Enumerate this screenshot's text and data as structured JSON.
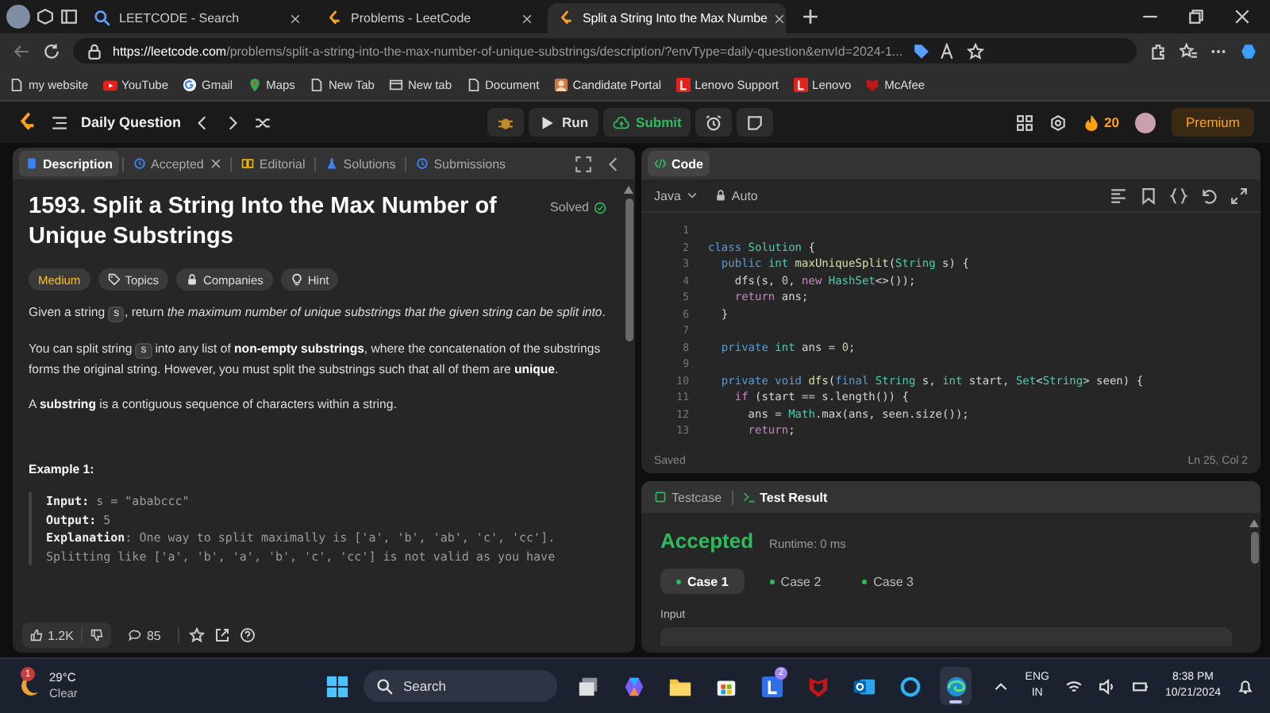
{
  "browser": {
    "tabs": [
      {
        "title": "LEETCODE - Search",
        "kind": "search",
        "selected": false
      },
      {
        "title": "Problems - LeetCode",
        "kind": "site",
        "selected": false
      },
      {
        "title": "Split a String Into the Max Numbe",
        "kind": "site",
        "selected": true
      }
    ],
    "url": {
      "host": "https://leetcode.com",
      "rest": "/problems/split-a-string-into-the-max-number-of-unique-substrings/description/?envType=daily-question&envId=2024-1..."
    },
    "bookmarks": [
      {
        "label": "my website",
        "kind": "page"
      },
      {
        "label": "YouTube",
        "kind": "youtube"
      },
      {
        "label": "Gmail",
        "kind": "google"
      },
      {
        "label": "Maps",
        "kind": "maps"
      },
      {
        "label": "New Tab",
        "kind": "page"
      },
      {
        "label": "New tab",
        "kind": "tab"
      },
      {
        "label": "Document",
        "kind": "page"
      },
      {
        "label": "Candidate Portal",
        "kind": "portal"
      },
      {
        "label": "Lenovo Support",
        "kind": "lenovo"
      },
      {
        "label": "Lenovo",
        "kind": "lenovo"
      },
      {
        "label": "McAfee",
        "kind": "mcafee"
      }
    ]
  },
  "header": {
    "title": "Daily Question",
    "run": "Run",
    "submit": "Submit",
    "streak": "20",
    "premium": "Premium"
  },
  "problem_panel": {
    "tabs": [
      {
        "label": "Description",
        "kind": "doc",
        "selected": true,
        "closable": false
      },
      {
        "label": "Accepted",
        "kind": "clock",
        "selected": false,
        "closable": true
      },
      {
        "label": "Editorial",
        "kind": "book",
        "selected": false,
        "closable": false
      },
      {
        "label": "Solutions",
        "kind": "flask",
        "selected": false,
        "closable": false
      },
      {
        "label": "Submissions",
        "kind": "clock",
        "selected": false,
        "closable": false
      }
    ],
    "title": "1593. Split a String Into the Max Number of Unique Substrings",
    "status": "Solved",
    "tags": [
      {
        "label": "Medium",
        "kind": "difficulty"
      },
      {
        "label": "Topics",
        "kind": "tag"
      },
      {
        "label": "Companies",
        "kind": "lock"
      },
      {
        "label": "Hint",
        "kind": "bulb"
      }
    ],
    "paragraphs": [
      [
        {
          "kind": "text",
          "text": "Given a string "
        },
        {
          "kind": "code",
          "text": "s"
        },
        {
          "kind": "text",
          "text": ", return *the maximum number of unique substrings that the given string can be split into*."
        }
      ],
      [
        {
          "kind": "text",
          "text": "You can split string "
        },
        {
          "kind": "code",
          "text": "s"
        },
        {
          "kind": "text",
          "text": " into any list of **non-empty substrings**, where the concatenation of the substrings forms the original string. However, you must split the substrings such that all of them are **unique**."
        }
      ],
      [
        {
          "kind": "text",
          "text": "A **substring** is a contiguous sequence of characters within a string."
        }
      ]
    ],
    "example": {
      "heading": "Example 1:",
      "lines": [
        "**Input:** s = \"ababccc\"",
        "**Output:** 5",
        "**Explanation**: One way to split maximally is ['a', 'b', 'ab', 'c', 'cc'].",
        "Splitting like ['a', 'b', 'a', 'b', 'c', 'cc'] is not valid as you have"
      ]
    },
    "likes": "1.2K",
    "comments": "85"
  },
  "code_panel": {
    "title": "Code",
    "language": "Java",
    "mode": "Auto",
    "lines": [
      {
        "number": "1"
      },
      {
        "number": "2",
        "tokens": [
          {
            "text": "class ",
            "kind": "kw"
          },
          {
            "text": "Solution",
            "kind": "type"
          },
          {
            "text": " {",
            "kind": "plain"
          }
        ]
      },
      {
        "number": "3",
        "tokens": [
          {
            "text": "  public ",
            "kind": "kw"
          },
          {
            "text": "int ",
            "kind": "type"
          },
          {
            "text": "maxUniqueSplit",
            "kind": "fn"
          },
          {
            "text": "(",
            "kind": "plain"
          },
          {
            "text": "String ",
            "kind": "type"
          },
          {
            "text": "s) {",
            "kind": "plain"
          }
        ]
      },
      {
        "number": "4",
        "tokens": [
          {
            "text": "    dfs(s, ",
            "kind": "plain"
          },
          {
            "text": "0",
            "kind": "num"
          },
          {
            "text": ", ",
            "kind": "plain"
          },
          {
            "text": "new ",
            "kind": "ctrl"
          },
          {
            "text": "HashSet",
            "kind": "type"
          },
          {
            "text": "<>());",
            "kind": "plain"
          }
        ]
      },
      {
        "number": "5",
        "tokens": [
          {
            "text": "    return ",
            "kind": "ctrl"
          },
          {
            "text": "ans;",
            "kind": "plain"
          }
        ]
      },
      {
        "number": "6",
        "tokens": [
          {
            "text": "  }",
            "kind": "plain"
          }
        ]
      },
      {
        "number": "7"
      },
      {
        "number": "8",
        "tokens": [
          {
            "text": "  private ",
            "kind": "kw"
          },
          {
            "text": "int ",
            "kind": "type"
          },
          {
            "text": "ans = ",
            "kind": "plain"
          },
          {
            "text": "0",
            "kind": "num"
          },
          {
            "text": ";",
            "kind": "plain"
          }
        ]
      },
      {
        "number": "9"
      },
      {
        "number": "10",
        "tokens": [
          {
            "text": "  private void ",
            "kind": "kw"
          },
          {
            "text": "dfs",
            "kind": "fn"
          },
          {
            "text": "(",
            "kind": "plain"
          },
          {
            "text": "final ",
            "kind": "kw"
          },
          {
            "text": "String ",
            "kind": "type"
          },
          {
            "text": "s, ",
            "kind": "plain"
          },
          {
            "text": "int ",
            "kind": "type"
          },
          {
            "text": "start, ",
            "kind": "plain"
          },
          {
            "text": "Set",
            "kind": "type"
          },
          {
            "text": "<",
            "kind": "plain"
          },
          {
            "text": "String",
            "kind": "type"
          },
          {
            "text": "> seen) {",
            "kind": "plain"
          }
        ]
      },
      {
        "number": "11",
        "tokens": [
          {
            "text": "    if ",
            "kind": "ctrl"
          },
          {
            "text": "(start == s.length()) {",
            "kind": "plain"
          }
        ]
      },
      {
        "number": "12",
        "tokens": [
          {
            "text": "      ans = ",
            "kind": "plain"
          },
          {
            "text": "Math",
            "kind": "type"
          },
          {
            "text": ".max(ans, seen.size());",
            "kind": "plain"
          }
        ]
      },
      {
        "number": "13",
        "tokens": [
          {
            "text": "      return",
            "kind": "ctrl"
          },
          {
            "text": ";",
            "kind": "plain"
          }
        ]
      }
    ],
    "status": "Saved",
    "position": "Ln 25, Col 2"
  },
  "test_panel": {
    "tabs": [
      {
        "label": "Testcase",
        "selected": false
      },
      {
        "label": "Test Result",
        "selected": true
      }
    ],
    "result": "Accepted",
    "runtime": "Runtime: 0 ms",
    "cases": [
      {
        "label": "Case 1",
        "passed": true,
        "selected": true
      },
      {
        "label": "Case 2",
        "passed": true,
        "selected": false
      },
      {
        "label": "Case 3",
        "passed": true,
        "selected": false
      }
    ],
    "input_label": "Input"
  },
  "taskbar": {
    "weather": {
      "temperature": "29°C",
      "condition": "Clear",
      "badge": "1"
    },
    "search": "Search",
    "apps": [
      {
        "kind": "taskview",
        "selected": false
      },
      {
        "kind": "copilot",
        "selected": false
      },
      {
        "kind": "explorer",
        "selected": false
      },
      {
        "kind": "store",
        "selected": false
      },
      {
        "kind": "lenovo",
        "selected": false,
        "badge": "2"
      },
      {
        "kind": "mcafee",
        "selected": false
      },
      {
        "kind": "outlook",
        "selected": false
      },
      {
        "kind": "cortana",
        "selected": false
      },
      {
        "kind": "edge",
        "selected": true
      }
    ],
    "language": "ENG",
    "region": "IN",
    "time": "8:38 PM",
    "date": "10/21/2024"
  }
}
